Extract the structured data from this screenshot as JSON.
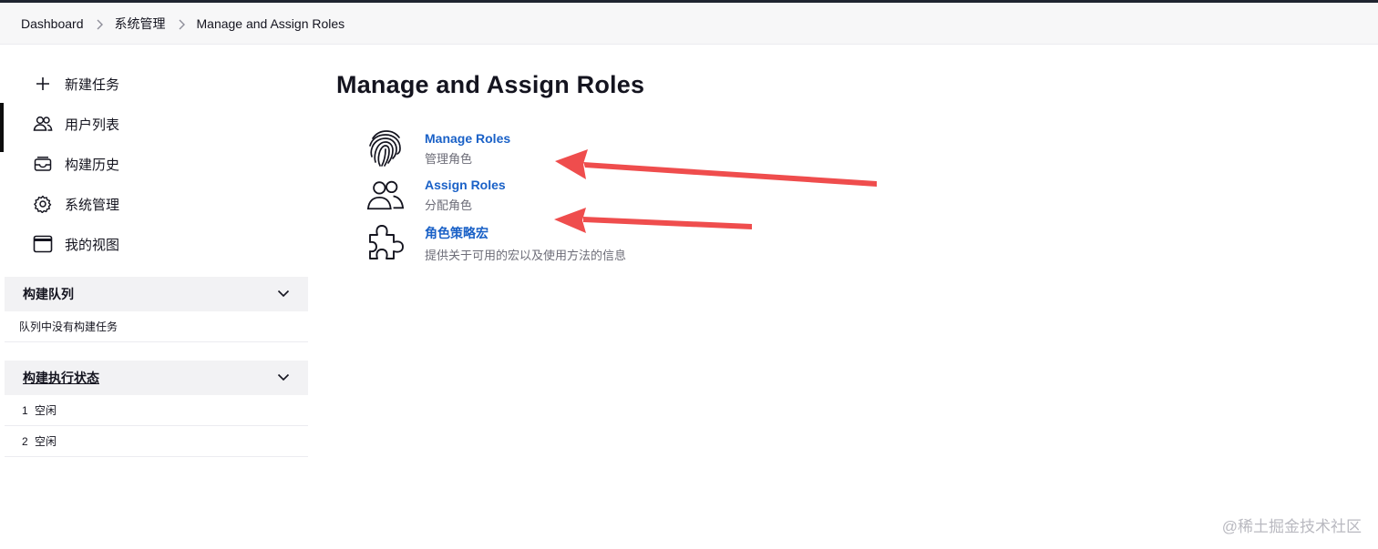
{
  "breadcrumb": {
    "items": [
      "Dashboard",
      "系统管理",
      "Manage and Assign Roles"
    ]
  },
  "sidebar": {
    "tasks": [
      {
        "label": "新建任务",
        "icon": "plus-icon"
      },
      {
        "label": "用户列表",
        "icon": "users-icon"
      },
      {
        "label": "构建历史",
        "icon": "history-icon"
      },
      {
        "label": "系统管理",
        "icon": "gear-icon"
      },
      {
        "label": "我的视图",
        "icon": "window-icon"
      }
    ],
    "build_queue": {
      "title": "构建队列",
      "empty_text": "队列中没有构建任务"
    },
    "executors": {
      "title": "构建执行状态",
      "rows": [
        {
          "num": "1",
          "status": "空闲"
        },
        {
          "num": "2",
          "status": "空闲"
        }
      ]
    }
  },
  "main": {
    "title": "Manage and Assign Roles",
    "items": [
      {
        "link": "Manage Roles",
        "desc": "管理角色",
        "icon": "fingerprint-icon"
      },
      {
        "link": "Assign Roles",
        "desc": "分配角色",
        "icon": "users-icon"
      },
      {
        "link": "角色策略宏",
        "desc": "提供关于可用的宏以及使用方法的信息",
        "icon": "puzzle-icon"
      }
    ]
  },
  "annotation": {
    "arrow_color": "#ef4d4d"
  },
  "watermark": "@稀土掘金技术社区"
}
